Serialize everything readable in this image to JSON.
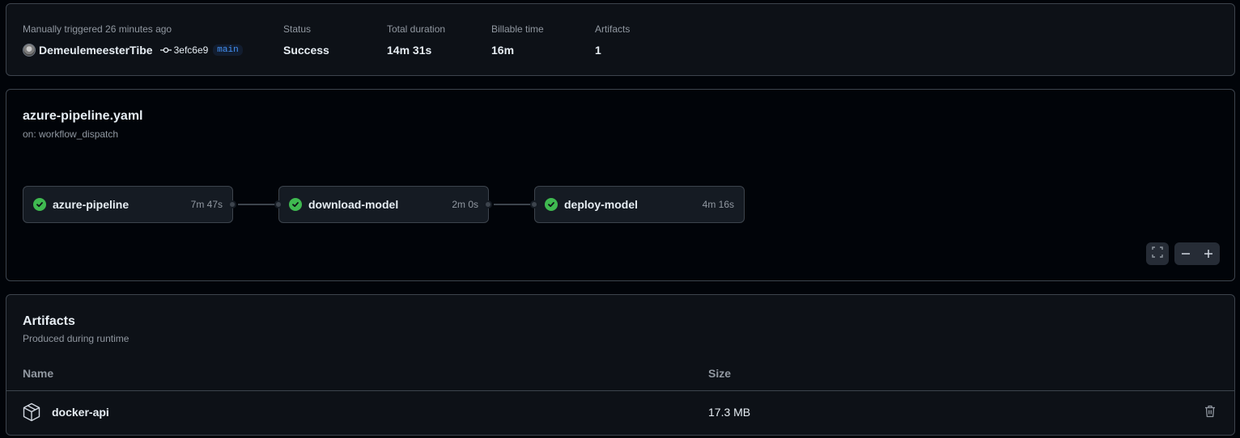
{
  "summary": {
    "trigger_label": "Manually triggered 26 minutes ago",
    "actor": "DemeulemeesterTibe",
    "commit_sha": "3efc6e9",
    "branch": "main",
    "status_label": "Status",
    "status_value": "Success",
    "duration_label": "Total duration",
    "duration_value": "14m 31s",
    "billable_label": "Billable time",
    "billable_value": "16m",
    "artifacts_label": "Artifacts",
    "artifacts_value": "1"
  },
  "workflow": {
    "file": "azure-pipeline.yaml",
    "trigger": "on: workflow_dispatch",
    "jobs": [
      {
        "name": "azure-pipeline",
        "time": "7m 47s",
        "status": "success"
      },
      {
        "name": "download-model",
        "time": "2m 0s",
        "status": "success"
      },
      {
        "name": "deploy-model",
        "time": "4m 16s",
        "status": "success"
      }
    ]
  },
  "artifacts": {
    "title": "Artifacts",
    "subtitle": "Produced during runtime",
    "columns": {
      "name": "Name",
      "size": "Size"
    },
    "items": [
      {
        "name": "docker-api",
        "size": "17.3 MB",
        "icon": "package-icon"
      }
    ]
  },
  "colors": {
    "success": "#3fb950",
    "accent": "#4493f8",
    "border": "#3d444d"
  }
}
